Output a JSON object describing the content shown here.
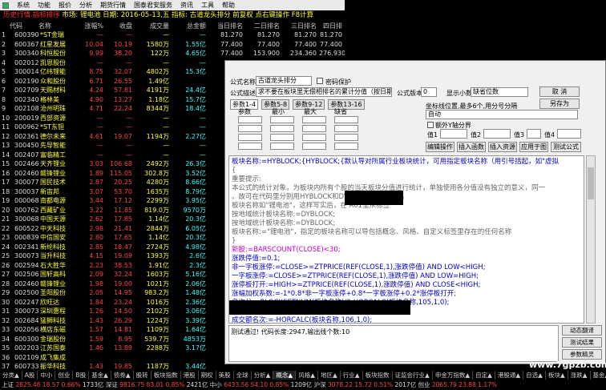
{
  "menu": {
    "items": [
      "系统",
      "功能",
      "报价",
      "分析",
      "期货行情",
      "国泰君安服务",
      "资讯",
      "工具",
      "帮助"
    ]
  },
  "list_title": {
    "prefix": "历史行情.指标排序",
    "rest": " 市场: 锂电池 日期: 2016-05-13,五 指标: 古道龙头排分  前复权  点右键操作 F8计算"
  },
  "table": {
    "headers": [
      "代码",
      "名称",
      "涨幅%",
      "收盘",
      "成交量",
      "总金额",
      "当日排名",
      "二日排名",
      "三日排名",
      "四日排"
    ],
    "rows": [
      {
        "idx": "1",
        "code": "600390",
        "name": "*ST金瑞",
        "chg": "—",
        "close": "—",
        "vol": "—",
        "amt": "—",
        "r1": "81.270",
        "r2": "81.270",
        "r3": "81.270",
        "r4": "81.270"
      },
      {
        "idx": "2",
        "code": "600367",
        "name": "红星发展",
        "chg": "10.04",
        "close": "10.19",
        "vol": "1580万",
        "amt": "1.55亿",
        "r1": "77.400",
        "r2": "77.400",
        "r3": "77.400",
        "r4": "77.400"
      },
      {
        "idx": "3",
        "code": "300340",
        "name": "科恒股份",
        "chg": "9.99",
        "close": "38.20",
        "vol": "122万",
        "amt": "4.65亿",
        "r1": "77.400",
        "r2": "153.900",
        "r3": "234.360",
        "r4": "276.930"
      },
      {
        "idx": "4",
        "code": "002012",
        "name": "凯恩股份",
        "chg": "—",
        "close": "—",
        "vol": "—",
        "amt": "—",
        "r1": "",
        "r2": "",
        "r3": "",
        "r4": ""
      },
      {
        "idx": "5",
        "code": "300014",
        "name": "亿纬锂能",
        "chg": "8.75",
        "close": "32.07",
        "vol": "4802万",
        "amt": "15.3亿",
        "r1": "",
        "r2": "",
        "r3": "",
        "r4": ""
      },
      {
        "idx": "6",
        "code": "002190",
        "name": "众和股份",
        "chg": "6.71",
        "close": "26.55",
        "vol": "1.49亿",
        "amt": "",
        "r1": "",
        "r2": "",
        "r3": "",
        "r4": ""
      },
      {
        "idx": "7",
        "code": "002709",
        "name": "天赐材料",
        "chg": "4.24",
        "close": "57.81",
        "vol": "4191万",
        "amt": "24.4亿",
        "r1": "",
        "r2": "",
        "r3": "",
        "r4": ""
      },
      {
        "idx": "8",
        "code": "002340",
        "name": "格林美",
        "chg": "4.90",
        "close": "13.27",
        "vol": "1.18亿",
        "amt": "15.7亿",
        "r1": "",
        "r2": "",
        "r3": "",
        "r4": ""
      },
      {
        "idx": "9",
        "code": "002108",
        "name": "沧州明珠",
        "chg": "4.71",
        "close": "22.24",
        "vol": "8344万",
        "amt": "18.4亿",
        "r1": "",
        "r2": "",
        "r3": "",
        "r4": ""
      },
      {
        "idx": "10",
        "code": "200019",
        "name": "西部资源",
        "chg": "—",
        "close": "—",
        "vol": "—",
        "amt": "—",
        "r1": "",
        "r2": "",
        "r3": "",
        "r4": ""
      },
      {
        "idx": "11",
        "code": "000962",
        "name": "*ST东钽",
        "chg": "—",
        "close": "—",
        "vol": "—",
        "amt": "—",
        "r1": "",
        "r2": "",
        "r3": "",
        "r4": ""
      },
      {
        "idx": "12",
        "code": "002361",
        "name": "德尔未来",
        "chg": "4.61",
        "close": "19.07",
        "vol": "1194万",
        "amt": "2.27亿",
        "r1": "",
        "r2": "",
        "r3": "",
        "r4": ""
      },
      {
        "idx": "13",
        "code": "300450",
        "name": "先导智能",
        "chg": "—",
        "close": "—",
        "vol": "—",
        "amt": "—",
        "r1": "",
        "r2": "",
        "r3": "",
        "r4": ""
      },
      {
        "idx": "14",
        "code": "002407",
        "name": "富临精工",
        "chg": "—",
        "close": "—",
        "vol": "—",
        "amt": "—",
        "r1": "",
        "r2": "",
        "r3": "",
        "r4": ""
      },
      {
        "idx": "15",
        "code": "002466",
        "name": "天齐锂业",
        "chg": "3.03",
        "close": "106.68",
        "vol": "2492万",
        "amt": "26.3亿",
        "r1": "",
        "r2": "",
        "r3": "",
        "r4": ""
      },
      {
        "idx": "16",
        "code": "002460",
        "name": "赣锋锂业",
        "chg": "1.89",
        "close": "115.05",
        "vol": "302.8万",
        "amt": "3.52亿",
        "r1": "",
        "r2": "",
        "r3": "",
        "r4": ""
      },
      {
        "idx": "17",
        "code": "300077",
        "name": "国民技术",
        "chg": "2.87",
        "close": "20.25",
        "vol": "4280万",
        "amt": "8.66亿",
        "r1": "",
        "r2": "",
        "r3": "",
        "r4": ""
      },
      {
        "idx": "18",
        "code": "300037",
        "name": "新宙邦",
        "chg": "3.07",
        "close": "53.70",
        "vol": "1635万",
        "amt": "8.79亿",
        "r1": "",
        "r2": "",
        "r3": "",
        "r4": ""
      },
      {
        "idx": "19",
        "code": "000068",
        "name": "南都电源",
        "chg": "3.44",
        "close": "17.12",
        "vol": "2299万",
        "amt": "3.95亿",
        "r1": "",
        "r2": "",
        "r3": "",
        "r4": ""
      },
      {
        "idx": "20",
        "code": "000762",
        "name": "西藏矿业",
        "chg": "3.22",
        "close": "11.85",
        "vol": "819.0万",
        "amt": "9570万",
        "r1": "",
        "r2": "",
        "r3": "",
        "r4": ""
      },
      {
        "idx": "21",
        "code": "300068",
        "name": "中国天源",
        "chg": "2.62",
        "close": "17.85",
        "vol": "1.14亿",
        "amt": "20.3亿",
        "r1": "",
        "r2": "",
        "r3": "",
        "r4": ""
      },
      {
        "idx": "22",
        "code": "600522",
        "name": "中天科技",
        "chg": "2.98",
        "close": "21.41",
        "vol": "2844万",
        "amt": "6.05亿",
        "r1": "",
        "r2": "",
        "r3": "",
        "r4": ""
      },
      {
        "idx": "23",
        "code": "000839",
        "name": "中信国安",
        "chg": "2.80",
        "close": "17.65",
        "vol": "1.14亿",
        "amt": "20.3亿",
        "r1": "",
        "r2": "",
        "r3": "",
        "r4": ""
      },
      {
        "idx": "24",
        "code": "002341",
        "name": "新纶科技",
        "chg": "2.85",
        "close": "18.47",
        "vol": "2724万",
        "amt": "4.98亿",
        "r1": "",
        "r2": "",
        "r3": "",
        "r4": ""
      },
      {
        "idx": "25",
        "code": "300073",
        "name": "当升科技",
        "chg": "4.15",
        "close": "19.09",
        "vol": "1393万",
        "amt": "2.6亿",
        "r1": "",
        "r2": "",
        "r3": "",
        "r4": ""
      },
      {
        "idx": "26",
        "code": "002594",
        "name": "石大胜华",
        "chg": "2.23",
        "close": "38.53",
        "vol": "1.91亿",
        "amt": "2.3亿",
        "r1": "",
        "r2": "",
        "r3": "",
        "r4": ""
      },
      {
        "idx": "27",
        "code": "002506",
        "name": "国轩高科",
        "chg": "2.09",
        "close": "32.24",
        "vol": "1603万",
        "amt": "5.16亿",
        "r1": "",
        "r2": "",
        "r3": "",
        "r4": ""
      },
      {
        "idx": "28",
        "code": "002460",
        "name": "赣锋锂业",
        "chg": "1.98",
        "close": "19.00",
        "vol": "1021万",
        "amt": "2.06亿",
        "r1": "",
        "r2": "",
        "r3": "",
        "r4": ""
      },
      {
        "idx": "29",
        "code": "002500",
        "name": "圣阳股份",
        "chg": "2.05",
        "close": "14.95",
        "vol": "983.2万",
        "amt": "1.48亿",
        "r1": "",
        "r2": "",
        "r3": "",
        "r4": ""
      },
      {
        "idx": "30",
        "code": "002247",
        "name": "欣旺达",
        "chg": "1.84",
        "close": "23.24",
        "vol": "1016万",
        "amt": "2.36亿",
        "r1": "",
        "r2": "",
        "r3": "",
        "r4": ""
      },
      {
        "idx": "31",
        "code": "300073",
        "name": "深圳惠程",
        "chg": "1.26",
        "close": "14.50",
        "vol": "2102万",
        "amt": "3.06亿",
        "r1": "",
        "r2": "",
        "r3": "",
        "r4": ""
      },
      {
        "idx": "32",
        "code": "002684",
        "name": "猛狮科技",
        "chg": "1.43",
        "close": "26.29",
        "vol": "1224万",
        "amt": "3.39亿",
        "r1": "",
        "r2": "",
        "r3": "",
        "r4": ""
      },
      {
        "idx": "33",
        "code": "002056",
        "name": "横店东磁",
        "chg": "1.57",
        "close": "14.81",
        "vol": "1109万",
        "amt": "1.64亿",
        "r1": "",
        "r2": "",
        "r3": "",
        "r4": ""
      },
      {
        "idx": "34",
        "code": "600300",
        "name": "金瑞股份",
        "chg": "1.59",
        "close": "8.95",
        "vol": "539.7万",
        "amt": "4853万",
        "r1": "",
        "r2": "",
        "r3": "",
        "r4": ""
      },
      {
        "idx": "35",
        "code": "002203",
        "name": "江苏国泰",
        "chg": "1.46",
        "close": "13.89",
        "vol": "2288万",
        "amt": "3.17亿",
        "r1": "",
        "r2": "",
        "r3": "",
        "r4": ""
      },
      {
        "idx": "36",
        "code": "002109",
        "name": "成飞集成",
        "chg": "",
        "close": "",
        "vol": "",
        "amt": "",
        "r1": "",
        "r2": "",
        "r3": "",
        "r4": ""
      },
      {
        "idx": "37",
        "code": "600733",
        "name": "振华科技",
        "chg": "1.43",
        "close": "19.85",
        "vol": "1187万",
        "amt": "3.44亿",
        "r1": "",
        "r2": "",
        "r3": "",
        "r4": ""
      }
    ]
  },
  "dialog": {
    "formula_name_label": "公式名称",
    "formula_name_value": "古道龙头排分",
    "password_label": "密码保护",
    "formula_desc_label": "公式描述",
    "formula_desc_value": "求不要在板块里无偿相排名的累计分值（按日期周末）",
    "version_label": "公式版本",
    "version_value": "0",
    "display_label": "显示小数",
    "display_value": "缺省位数",
    "cancel_label": "取 消",
    "saveas_label": "另存为",
    "param_tabs": [
      "参数1-4",
      "参数5-8",
      "参数9-12",
      "参数13-16"
    ],
    "param_headers": [
      "参数",
      "最小",
      "最大",
      "缺省"
    ],
    "axis_label": "坐标线位置,最多6个,用分号分隔",
    "axis_value": "自动",
    "extra_axis_label": "额外Y轴分界",
    "axis_val_labels": [
      "值1",
      "值2",
      "值3",
      "值4"
    ],
    "btn_edit": "编辑操作",
    "btn_insert_func": "插入函数",
    "btn_insert_res": "插入资源",
    "btn_apply": "应用于图",
    "btn_test": "测试公式",
    "status_text": "测试通过! 代码长度:2947,输出线个数:10",
    "btn_dynamic": "动态翻译",
    "btn_test2": "测试结果",
    "btn_params": "参数精灵"
  },
  "code_lines": [
    {
      "cls": "c-blue",
      "text": "板块名称:=HYBLOCK;{HYBLOCK;{默认导对所属行业板块统计，可用指定板块名称（用引号括起，如\"虚拟"
    },
    {
      "cls": "c-gray",
      "text": "{"
    },
    {
      "cls": "c-gray",
      "text": "重要提示:"
    },
    {
      "cls": "c-gray",
      "text": "本公式的统计对象，为板块内所有个股的当天板块分值进行统计，单独使用各分值没有独立的意义，同一"
    },
    {
      "cls": "c-gray",
      "text": "                                        。故可在代码里分别用HYBLOCK和DYBLOCK指代板块名"
    },
    {
      "cls": "c-gray",
      "text": "                                        板块名称如\"锂电池\"，这样写实后，在 A01里从标签"
    },
    {
      "cls": "c-gray",
      "text": "按地域统计板块名称:=DYBLOCK;"
    },
    {
      "cls": "c-gray",
      "text": "按地域统计板块名称:=DYBLOCK;"
    },
    {
      "cls": "c-gray",
      "text": "板块名称:=\"锂电池\"，指定的板块名称可以导包括概念、风格、自定义标签里存在的任何名称"
    },
    {
      "cls": "c-gray",
      "text": "}"
    },
    {
      "cls": "c-pink",
      "text": "新股:=BARSCOUNT(CLOSE)<30;"
    },
    {
      "cls": "c-blue",
      "text": "涨跌停值:=0.1;"
    },
    {
      "cls": "c-blue",
      "text": "非一字板涨停:=CLOSE>=ZTPRICE(REF(CLOSE,1),涨跌停值) AND LOW<HIGH;"
    },
    {
      "cls": "c-blue",
      "text": "一字板涨停:=CLOSE>=ZTPRICE(REF(CLOSE,1),涨跌停值) AND LOW=HIGH;"
    },
    {
      "cls": "c-blue",
      "text": "涨停板打开:=HIGH>=ZTPRICE(REF(CLOSE,1),涨跌停值) AND CLOSE<HIGH;"
    },
    {
      "cls": "c-blue",
      "text": "涨幅加权系数:=-1*0.8*非一字板涨停+0.8*一字板涨停+0.2*涨停板打开;"
    },
    {
      "cls": "c-blue",
      "text": ""
    },
    {
      "cls": "c-blue",
      "text": "名次分:=BLOCKSETNUM(板块名称)/2-HORCALC(板块名称,105,1,0);"
    },
    {
      "cls": "c-blue",
      "text": "名次排名名次分:=IF(名次分<0,0,名次分);"
    },
    {
      "cls": "c-blue",
      "text": ""
    },
    {
      "cls": "c-blue",
      "text": "成交额名次:=-HORCALC(板块名称,106,1,0);"
    }
  ],
  "tabs": [
    "分类▲",
    "A股",
    "中小",
    "创业",
    "B股",
    "基金▲",
    "债券▲",
    "股转",
    "板块指数",
    "港股",
    "期权",
    "美股",
    "全球",
    "分析▲",
    "概念▲",
    "风格▲",
    "地区▲",
    "行业▲",
    "板块指数",
    "证监会行业▲",
    "申金万指数▲",
    "自定▲",
    "港股通▲",
    "自选▲",
    "板块▲",
    "涨跌▲",
    "基金▲"
  ],
  "ticker": {
    "sh_label": "上证",
    "sh_value": "2825.48",
    "sh_chg": "18.57",
    "sh_pct": "0.66%",
    "sh_amt": "1733亿",
    "sz_label": "深证",
    "sz_value": "9816.75",
    "sz_chg": "83.01",
    "sz_pct": "0.85%",
    "sz_amt": "2421亿",
    "zx_label": "中小",
    "zx_value": "6433.56",
    "zx_chg": "54.10",
    "zx_pct": "0.85%",
    "zx_amt": "1209亿",
    "hs_label": "沪深",
    "hs_value": "3078.22",
    "hs_chg": "15.72",
    "hs_pct": "0.51%",
    "hs_amt": "2017亿",
    "cy_label": "创业",
    "cy_value": "2065.79",
    "cy_chg": "23.88",
    "cy_pct": "1.17%"
  },
  "watermark": "www.7gpzb.com"
}
